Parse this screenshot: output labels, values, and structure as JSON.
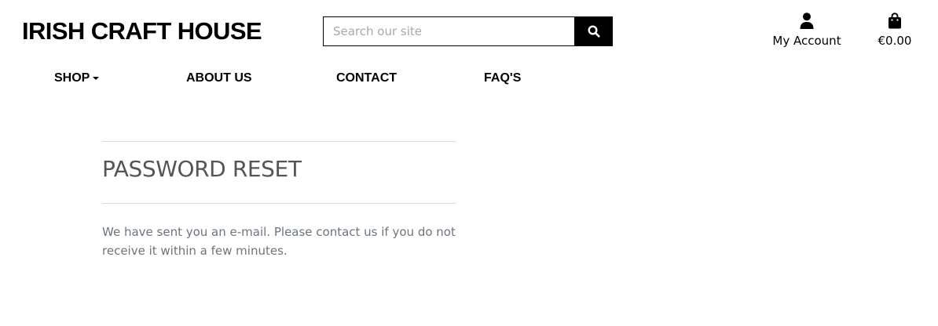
{
  "header": {
    "brand": "IRISH CRAFT HOUSE",
    "search": {
      "placeholder": "Search our site",
      "value": "",
      "button_icon": "search-icon"
    },
    "account": {
      "label": "My Account",
      "icon": "user-icon"
    },
    "bag": {
      "total": "€0.00",
      "icon": "shopping-bag-icon"
    }
  },
  "nav": {
    "items": [
      {
        "label": "SHOP",
        "has_dropdown": true
      },
      {
        "label": "ABOUT US"
      },
      {
        "label": "CONTACT"
      },
      {
        "label": "FAQ'S"
      }
    ]
  },
  "main": {
    "title": "PASSWORD RESET",
    "message": "We have sent you an e-mail. Please contact us if you do not receive it within a few minutes."
  },
  "colors": {
    "text_primary": "#000000",
    "heading": "#555555",
    "muted": "#6c757d",
    "divider": "#dddddd",
    "search_button": "#000000"
  }
}
